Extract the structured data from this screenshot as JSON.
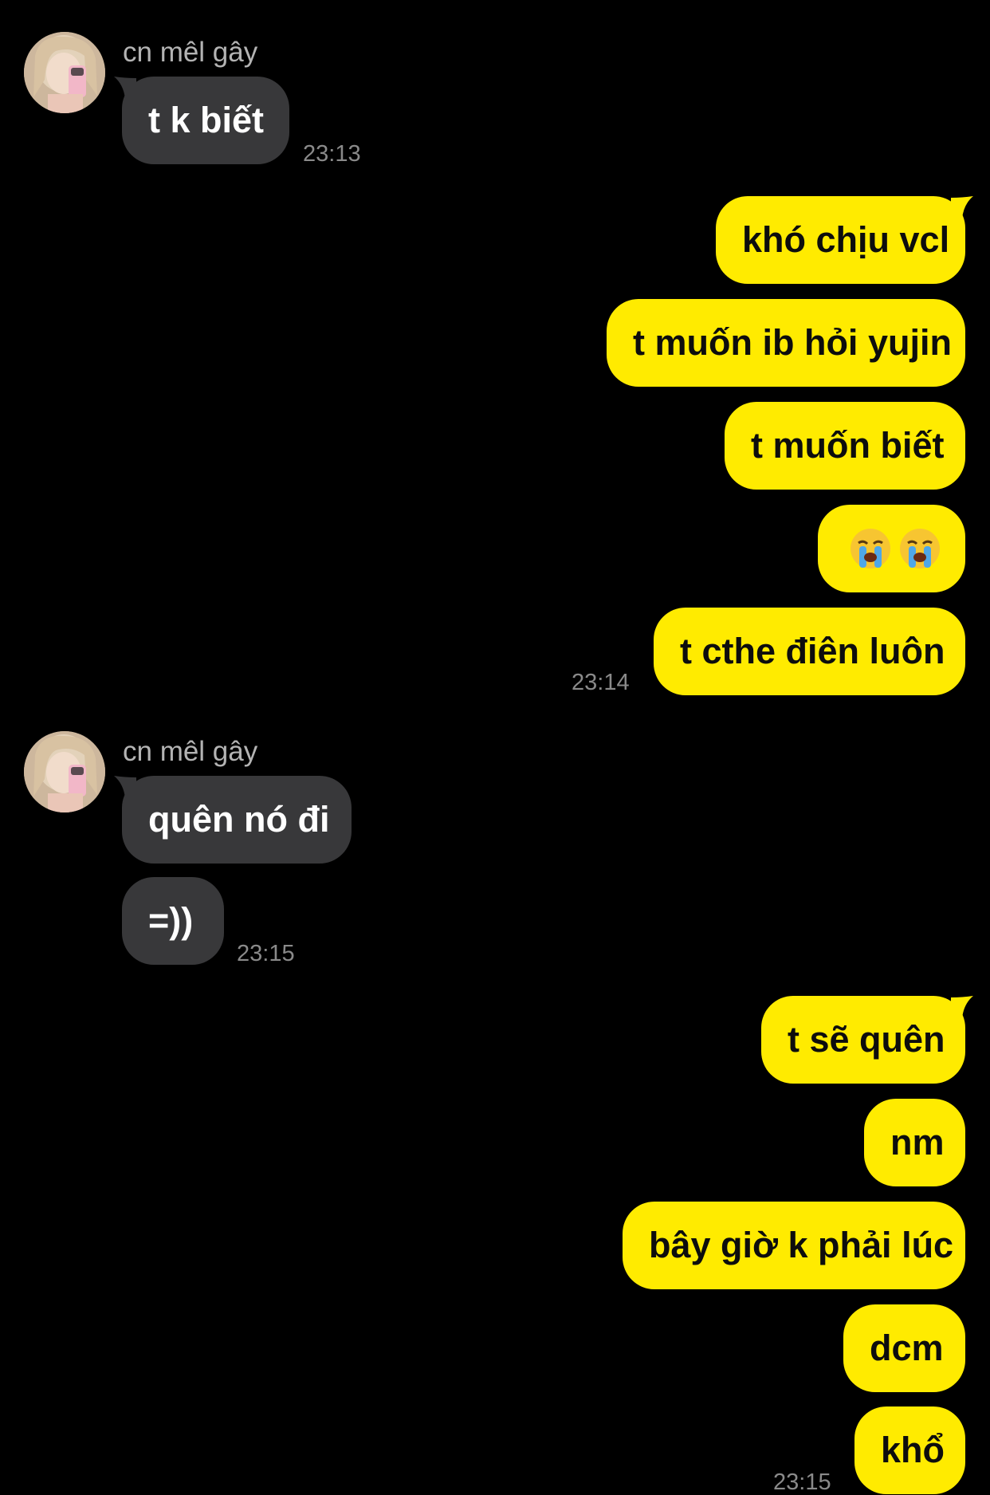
{
  "conversation": {
    "groups": [
      {
        "side": "in",
        "sender": "cn mêl gây",
        "messages": [
          "t k biết"
        ],
        "time": "23:13"
      },
      {
        "side": "out",
        "messages": [
          "khó chịu vcl",
          "t muốn ib hỏi yujin",
          "t muốn biết",
          "😭😭",
          "t cthe điên luôn"
        ],
        "time": "23:14"
      },
      {
        "side": "in",
        "sender": "cn mêl gây",
        "messages": [
          "quên nó đi",
          "=))"
        ],
        "time": "23:15"
      },
      {
        "side": "out",
        "messages": [
          "t sẽ quên",
          "nm",
          "bây giờ k phải lúc",
          "dcm",
          "khổ"
        ],
        "time": "23:15"
      }
    ]
  },
  "icons": {
    "avatar": "profile-photo",
    "emoji": "loudly-crying-face"
  },
  "colors": {
    "background": "#000000",
    "incoming_bubble": "#38383a",
    "outgoing_bubble": "#ffeb00",
    "incoming_text": "#ffffff",
    "outgoing_text": "#0d0d0d",
    "sender_name": "#b3b3b3",
    "timestamp": "#8a8a8a"
  }
}
